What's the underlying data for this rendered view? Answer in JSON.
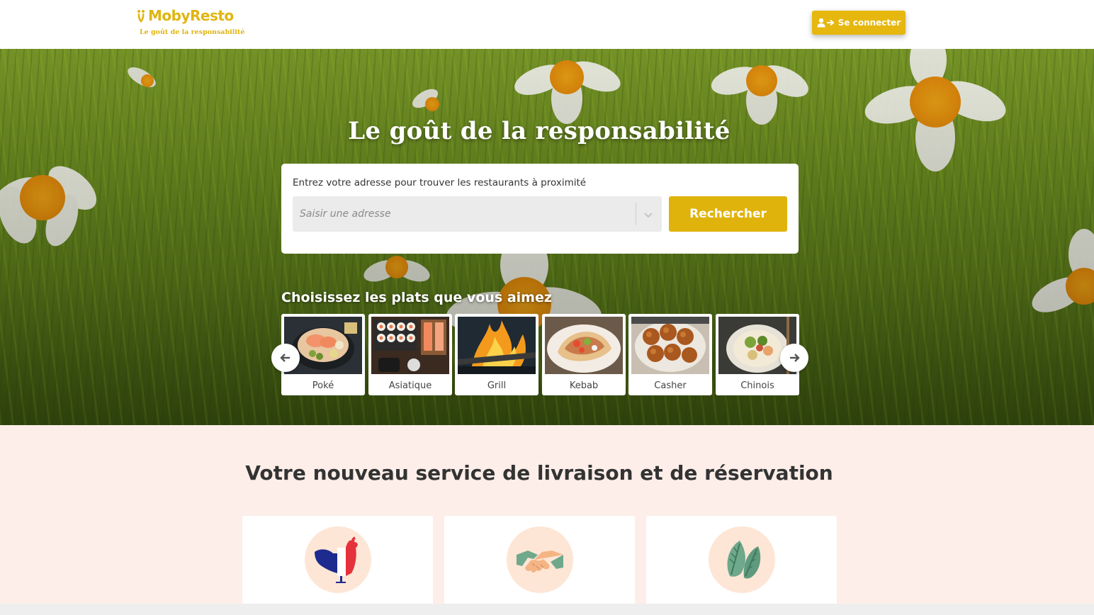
{
  "header": {
    "logo_name": "MobyResto",
    "logo_tagline": "Le goût de la responsabilité",
    "login_label": "Se connecter",
    "login_icon": "user-login-icon",
    "brand_color": "#e0b510"
  },
  "hero": {
    "title": "Le goût de la responsabilité",
    "search": {
      "label": "Entrez votre adresse pour trouver les restaurants à proximité",
      "placeholder": "Saisir une adresse",
      "value": "",
      "button_label": "Rechercher",
      "button_color": "#e0b30c"
    },
    "dishes_title": "Choisissez les plats que vous aimez",
    "dishes": [
      {
        "label": "Poké"
      },
      {
        "label": "Asiatique"
      },
      {
        "label": "Grill"
      },
      {
        "label": "Kebab"
      },
      {
        "label": "Casher"
      },
      {
        "label": "Chinois"
      }
    ],
    "prev_icon": "arrow-left-icon",
    "next_icon": "arrow-right-icon"
  },
  "services": {
    "title": "Votre nouveau service de livraison et de réservation",
    "background": "#fdeee9",
    "cards": [
      {
        "icon": "french-rooster-icon"
      },
      {
        "icon": "handshake-icon"
      },
      {
        "icon": "leaf-icon"
      }
    ]
  }
}
